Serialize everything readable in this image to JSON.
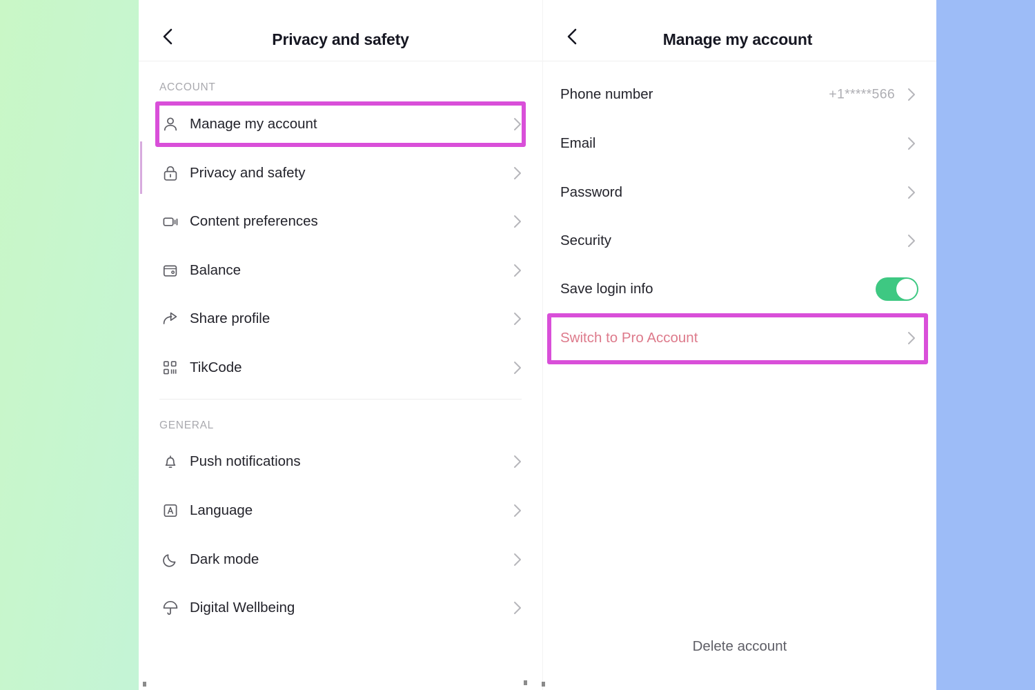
{
  "background": {
    "left_color": "#c9f7c6",
    "right_color": "#9dbcf7"
  },
  "theme": {
    "highlight_border": "#d94fd9",
    "toggle_on": "#3ec882",
    "pro_link": "#dd7a8b",
    "title_color": "#161722",
    "section_label_color": "#a9a9ae"
  },
  "left_panel": {
    "header": {
      "back_icon": "chevron-left-icon",
      "title": "Privacy and safety"
    },
    "sections": [
      {
        "label": "ACCOUNT",
        "items": [
          {
            "label": "Manage my account",
            "icon": "person-icon",
            "highlighted": true
          },
          {
            "label": "Privacy and safety",
            "icon": "lock-icon",
            "highlighted": false
          },
          {
            "label": "Content preferences",
            "icon": "video-icon",
            "highlighted": false
          },
          {
            "label": "Balance",
            "icon": "wallet-icon",
            "highlighted": false
          },
          {
            "label": "Share profile",
            "icon": "share-icon",
            "highlighted": false
          },
          {
            "label": "TikCode",
            "icon": "qr-code-icon",
            "highlighted": false
          }
        ]
      },
      {
        "label": "GENERAL",
        "items": [
          {
            "label": "Push notifications",
            "icon": "bell-icon",
            "highlighted": false
          },
          {
            "label": "Language",
            "icon": "language-icon",
            "highlighted": false
          },
          {
            "label": "Dark mode",
            "icon": "moon-icon",
            "highlighted": false
          },
          {
            "label": "Digital Wellbeing",
            "icon": "umbrella-icon",
            "highlighted": false
          }
        ]
      }
    ]
  },
  "right_panel": {
    "header": {
      "back_icon": "chevron-left-icon",
      "title": "Manage my account"
    },
    "items": [
      {
        "label": "Phone number",
        "value": "+1*****566",
        "type": "link"
      },
      {
        "label": "Email",
        "value": "",
        "type": "link"
      },
      {
        "label": "Password",
        "value": "",
        "type": "link"
      },
      {
        "label": "Security",
        "value": "",
        "type": "link"
      },
      {
        "label": "Save login info",
        "value": "",
        "type": "toggle",
        "toggle_on": true
      },
      {
        "label": "Switch to Pro Account",
        "value": "",
        "type": "link",
        "highlighted": true
      }
    ],
    "footer": {
      "delete_account": "Delete account"
    }
  }
}
